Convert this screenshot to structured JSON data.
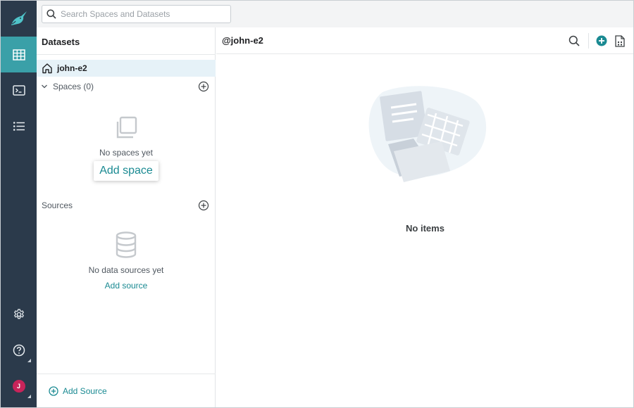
{
  "search": {
    "placeholder": "Search Spaces and Datasets"
  },
  "rail": {
    "items": [
      {
        "name": "datasets",
        "icon": "grid-table-icon",
        "active": true
      },
      {
        "name": "sql-runner",
        "icon": "terminal-icon",
        "active": false
      },
      {
        "name": "jobs",
        "icon": "list-icon",
        "active": false
      }
    ],
    "bottom": [
      {
        "name": "settings",
        "icon": "gear-icon"
      },
      {
        "name": "help",
        "icon": "help-circle-icon"
      }
    ],
    "avatar_initial": "J",
    "avatar_color": "#c8245a",
    "accent_color": "#3aa0a8"
  },
  "panel": {
    "title": "Datasets",
    "home_label": "john-e2",
    "spaces_label": "Spaces (0)",
    "spaces_empty": "No spaces yet",
    "add_space": "Add space",
    "sources_label": "Sources",
    "sources_empty": "No data sources yet",
    "add_source": "Add source",
    "bottom_add_source": "Add Source"
  },
  "main": {
    "title": "@john-e2",
    "empty": "No items"
  },
  "colors": {
    "link": "#1a8a92",
    "rail": "#2b3a4b",
    "selected_row": "#e6f2f8"
  }
}
